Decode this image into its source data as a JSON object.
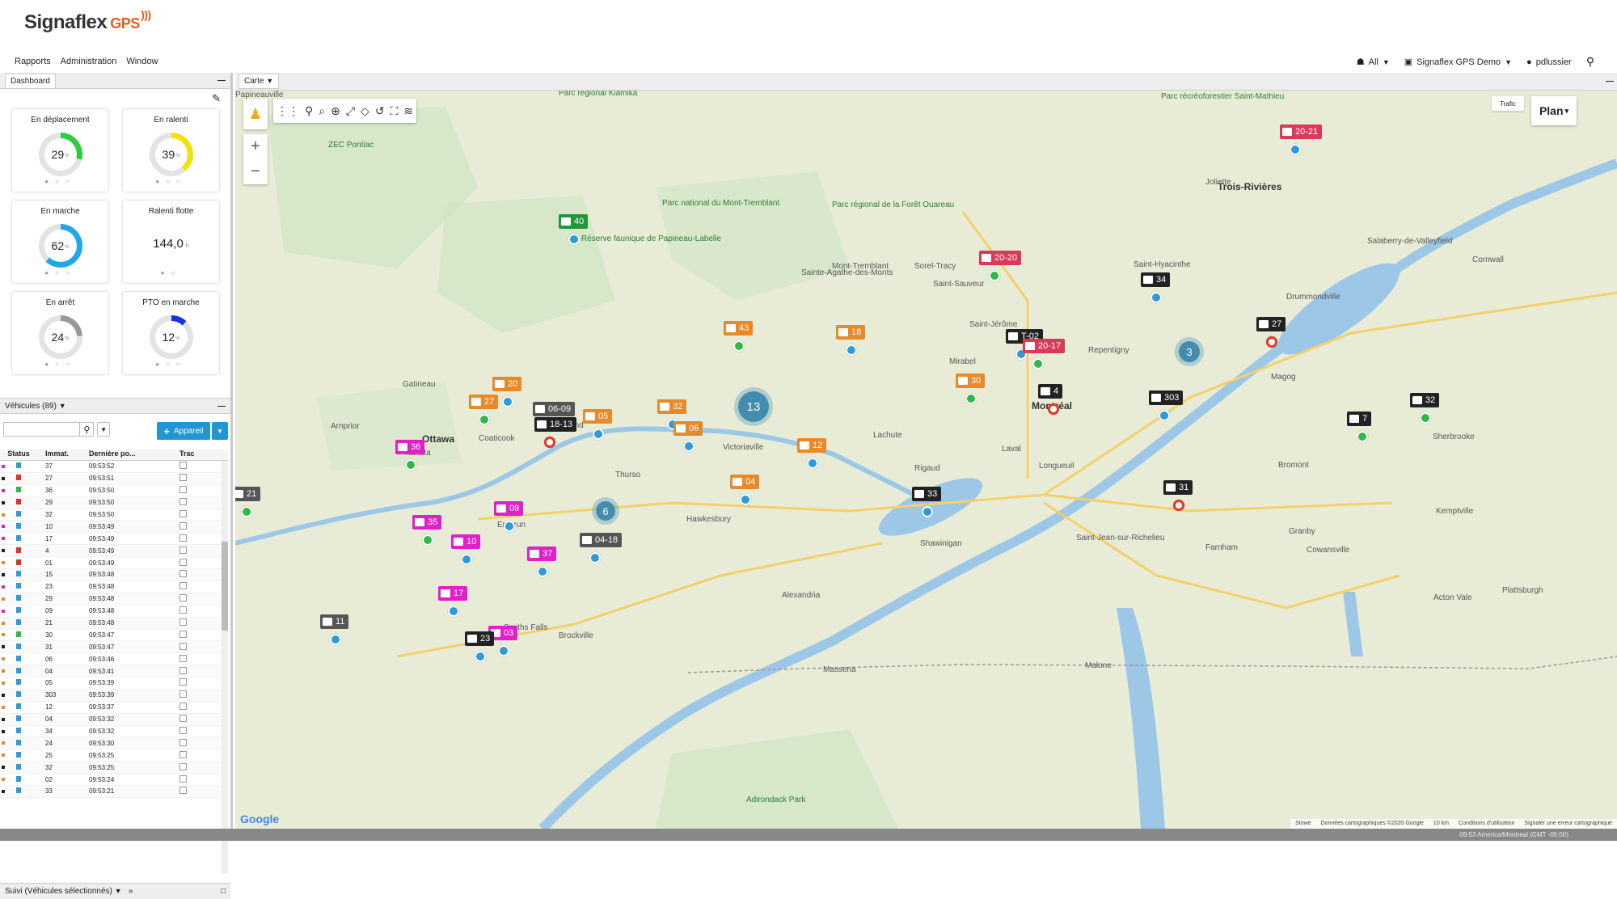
{
  "app": {
    "logo": "Signaflex",
    "logo_suffix": "GPS"
  },
  "menu": [
    "Rapports",
    "Administration",
    "Window"
  ],
  "right_menu": {
    "filter": "All",
    "account": "Signaflex GPS Demo",
    "user": "pdlussier"
  },
  "dashboard": {
    "tab": "Dashboard",
    "gauges": [
      {
        "title": "En déplacement",
        "value": "29",
        "unit": "%",
        "pct": 29,
        "color": "#2ecc40"
      },
      {
        "title": "En ralenti",
        "value": "39",
        "unit": "%",
        "pct": 39,
        "color": "#f2e20a"
      },
      {
        "title": "En marche",
        "value": "62",
        "unit": "%",
        "pct": 62,
        "color": "#1ea8e8"
      },
      {
        "title": "Ralenti flotte",
        "value": "144,0",
        "unit": "h",
        "pct": null,
        "color": ""
      },
      {
        "title": "En arrêt",
        "value": "24",
        "unit": "%",
        "pct": 24,
        "color": "#999999"
      },
      {
        "title": "PTO en marche",
        "value": "12",
        "unit": "%",
        "pct": 12,
        "color": "#1533e0"
      }
    ]
  },
  "vehicles": {
    "tab": "Véhicules (89)",
    "add_label": "Appareil",
    "columns": [
      "Status",
      "Immat.",
      "Dernière po...",
      "Tracé"
    ],
    "rows": [
      {
        "im": "37",
        "t": "09:53:52",
        "c": "#e020c8",
        "s": "#2e9ad6"
      },
      {
        "im": "27",
        "t": "09:53:51",
        "c": "#222",
        "s": "#d9352a"
      },
      {
        "im": "36",
        "t": "09:53:50",
        "c": "#e020c8",
        "s": "#32b848"
      },
      {
        "im": "29",
        "t": "09:53:50",
        "c": "#222",
        "s": "#d9352a"
      },
      {
        "im": "32",
        "t": "09:53:50",
        "c": "#e8892a",
        "s": "#2e9ad6"
      },
      {
        "im": "10",
        "t": "09:53:49",
        "c": "#e020c8",
        "s": "#2e9ad6"
      },
      {
        "im": "17",
        "t": "09:53:49",
        "c": "#e020c8",
        "s": "#2e9ad6"
      },
      {
        "im": "4",
        "t": "09:53:49",
        "c": "#222",
        "s": "#d9352a"
      },
      {
        "im": "01",
        "t": "09:53:49",
        "c": "#e8892a",
        "s": "#d9352a"
      },
      {
        "im": "15",
        "t": "09:53:48",
        "c": "#222",
        "s": "#2e9ad6"
      },
      {
        "im": "23",
        "t": "09:53:48",
        "c": "#e020c8",
        "s": "#2e9ad6"
      },
      {
        "im": "29",
        "t": "09:53:48",
        "c": "#e8892a",
        "s": "#2e9ad6"
      },
      {
        "im": "09",
        "t": "09:53:48",
        "c": "#e020c8",
        "s": "#2e9ad6"
      },
      {
        "im": "21",
        "t": "09:53:48",
        "c": "#e8892a",
        "s": "#2e9ad6"
      },
      {
        "im": "30",
        "t": "09:53:47",
        "c": "#e8892a",
        "s": "#32b848"
      },
      {
        "im": "31",
        "t": "09:53:47",
        "c": "#222",
        "s": "#2e9ad6"
      },
      {
        "im": "06",
        "t": "09:53:46",
        "c": "#e8892a",
        "s": "#2e9ad6"
      },
      {
        "im": "04",
        "t": "09:53:41",
        "c": "#e8892a",
        "s": "#2e9ad6"
      },
      {
        "im": "05",
        "t": "09:53:39",
        "c": "#e8892a",
        "s": "#2e9ad6"
      },
      {
        "im": "303",
        "t": "09:53:39",
        "c": "#222",
        "s": "#2e9ad6"
      },
      {
        "im": "12",
        "t": "09:53:37",
        "c": "#e8892a",
        "s": "#2e9ad6"
      },
      {
        "im": "04",
        "t": "09:53:32",
        "c": "#222",
        "s": "#2e9ad6"
      },
      {
        "im": "34",
        "t": "09:53:32",
        "c": "#222",
        "s": "#2e9ad6"
      },
      {
        "im": "24",
        "t": "09:53:30",
        "c": "#e8892a",
        "s": "#2e9ad6"
      },
      {
        "im": "25",
        "t": "09:53:25",
        "c": "#e8892a",
        "s": "#2e9ad6"
      },
      {
        "im": "32",
        "t": "09:53:25",
        "c": "#222",
        "s": "#2e9ad6"
      },
      {
        "im": "02",
        "t": "09:53:24",
        "c": "#e8892a",
        "s": "#2e9ad6"
      },
      {
        "im": "33",
        "t": "09:53:21",
        "c": "#222",
        "s": "#2e9ad6"
      }
    ]
  },
  "suivi": "Suivi (Véhicules sélectionnés)",
  "map": {
    "tab": "Carte",
    "plan": "Plan",
    "traffic": "Trafic",
    "footer": [
      "Stowe",
      "Données cartographiques ©2020 Google",
      "10 km",
      "Conditions d'utilisation",
      "Signaler une erreur cartographique"
    ],
    "google": "Google",
    "places": [
      {
        "n": "Trois-Rivières",
        "big": true
      },
      {
        "n": "Montréal",
        "big": true
      },
      {
        "n": "Laval",
        "big": false
      },
      {
        "n": "Longueuil",
        "big": false
      },
      {
        "n": "Ottawa",
        "big": true
      },
      {
        "n": "Gatineau",
        "big": false
      },
      {
        "n": "Sherbrooke",
        "big": false
      },
      {
        "n": "Saint-Jérôme",
        "big": false
      },
      {
        "n": "Saint-Jean-sur-Richelieu",
        "big": false
      },
      {
        "n": "Granby",
        "big": false
      },
      {
        "n": "Drummondville",
        "big": false
      },
      {
        "n": "Cornwall",
        "big": false
      },
      {
        "n": "Salaberry-de-Valleyfield",
        "big": false
      },
      {
        "n": "Hawkesbury",
        "big": false
      },
      {
        "n": "Shawinigan",
        "big": false
      },
      {
        "n": "Victoriaville",
        "big": false
      },
      {
        "n": "Joliette",
        "big": false
      },
      {
        "n": "Sorel-Tracy",
        "big": false
      },
      {
        "n": "Saint-Hyacinthe",
        "big": false
      },
      {
        "n": "Magog",
        "big": false
      },
      {
        "n": "Kemptville",
        "big": false
      },
      {
        "n": "Brockville",
        "big": false
      },
      {
        "n": "Smiths Falls",
        "big": false
      },
      {
        "n": "Mont-Tremblant",
        "big": false
      },
      {
        "n": "Lachute",
        "big": false
      },
      {
        "n": "Rigaud",
        "big": false
      },
      {
        "n": "Alexandria",
        "big": false
      },
      {
        "n": "Plattsburgh",
        "big": false
      },
      {
        "n": "Malone",
        "big": false
      },
      {
        "n": "Massena",
        "big": false
      },
      {
        "n": "Arnprior",
        "big": false
      },
      {
        "n": "Kanata",
        "big": false
      },
      {
        "n": "Rockland",
        "big": false
      },
      {
        "n": "Embrun",
        "big": false
      },
      {
        "n": "Repentigny",
        "big": false
      },
      {
        "n": "Saint-Sauveur",
        "big": false
      },
      {
        "n": "Mirabel",
        "big": false
      },
      {
        "n": "Sainte-Agathe-des-Monts",
        "big": false
      },
      {
        "n": "Cowansville",
        "big": false
      },
      {
        "n": "Farnham",
        "big": false
      },
      {
        "n": "Bromont",
        "big": false
      },
      {
        "n": "Acton Vale",
        "big": false
      },
      {
        "n": "Coaticook",
        "big": false
      },
      {
        "n": "Thurso",
        "big": false
      },
      {
        "n": "Papineauville",
        "big": false
      }
    ],
    "parks": [
      "Parc régional Kiamika",
      "Réserve faunique de Papineau-Labelle",
      "Parc national du Mont-Tremblant",
      "Parc régional de la Forêt Ouareau",
      "ZEC Pontiac",
      "Parc récréoforestier Saint-Mathieu",
      "Adirondack Park"
    ],
    "markers": [
      {
        "label": "40",
        "col": "green"
      },
      {
        "label": "20-21",
        "col": "red"
      },
      {
        "label": "20-20",
        "col": "red"
      },
      {
        "label": "34",
        "col": "black"
      },
      {
        "label": "43",
        "col": "orange"
      },
      {
        "label": "18",
        "col": "orange"
      },
      {
        "label": "T-02",
        "col": "black"
      },
      {
        "label": "20-17",
        "col": "red"
      },
      {
        "label": "27",
        "col": "black"
      },
      {
        "label": "20",
        "col": "orange"
      },
      {
        "label": "27",
        "col": "orange"
      },
      {
        "label": "06-09",
        "col": "gray"
      },
      {
        "label": "18-13",
        "col": "black"
      },
      {
        "label": "05",
        "col": "orange"
      },
      {
        "label": "32",
        "col": "orange"
      },
      {
        "label": "06",
        "col": "orange"
      },
      {
        "label": "30",
        "col": "orange"
      },
      {
        "label": "4",
        "col": "black"
      },
      {
        "label": "303",
        "col": "black"
      },
      {
        "label": "32",
        "col": "black"
      },
      {
        "label": "7",
        "col": "black"
      },
      {
        "label": "36",
        "col": "magenta"
      },
      {
        "label": "12",
        "col": "orange"
      },
      {
        "label": "04",
        "col": "orange"
      },
      {
        "label": "33",
        "col": "black"
      },
      {
        "label": "31",
        "col": "black"
      },
      {
        "label": "09",
        "col": "magenta"
      },
      {
        "label": "35",
        "col": "magenta"
      },
      {
        "label": "10",
        "col": "magenta"
      },
      {
        "label": "37",
        "col": "magenta"
      },
      {
        "label": "04-18",
        "col": "gray"
      },
      {
        "label": "17",
        "col": "magenta"
      },
      {
        "label": "11",
        "col": "gray"
      },
      {
        "label": "03",
        "col": "magenta"
      },
      {
        "label": "23",
        "col": "black"
      },
      {
        "label": "21",
        "col": "gray"
      }
    ],
    "clusters": [
      "13",
      "3",
      "6"
    ]
  },
  "status": "09:53 America/Montreal (GMT -05:00)"
}
